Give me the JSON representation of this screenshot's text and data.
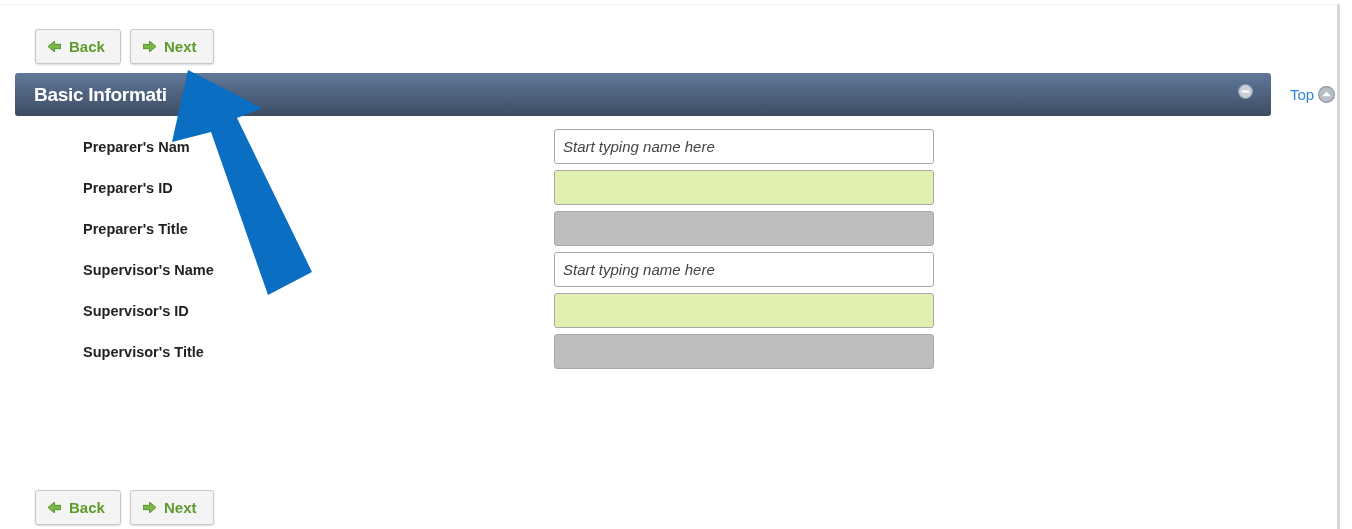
{
  "nav_top": {
    "back": "Back",
    "next": "Next"
  },
  "section": {
    "title": "Basic Informati",
    "expanded": true,
    "top_link": "Top"
  },
  "fields": [
    {
      "label": "Preparer's Nam",
      "kind": "lookup",
      "placeholder": "Start typing name here"
    },
    {
      "label": "Preparer's ID",
      "kind": "required"
    },
    {
      "label": "Preparer's Title",
      "kind": "readonly"
    },
    {
      "label": "Supervisor's Name",
      "kind": "lookup",
      "placeholder": "Start typing name here"
    },
    {
      "label": "Supervisor's ID",
      "kind": "required"
    },
    {
      "label": "Supervisor's Title",
      "kind": "readonly"
    }
  ],
  "nav_bottom": {
    "back": "Back",
    "next": "Next"
  }
}
